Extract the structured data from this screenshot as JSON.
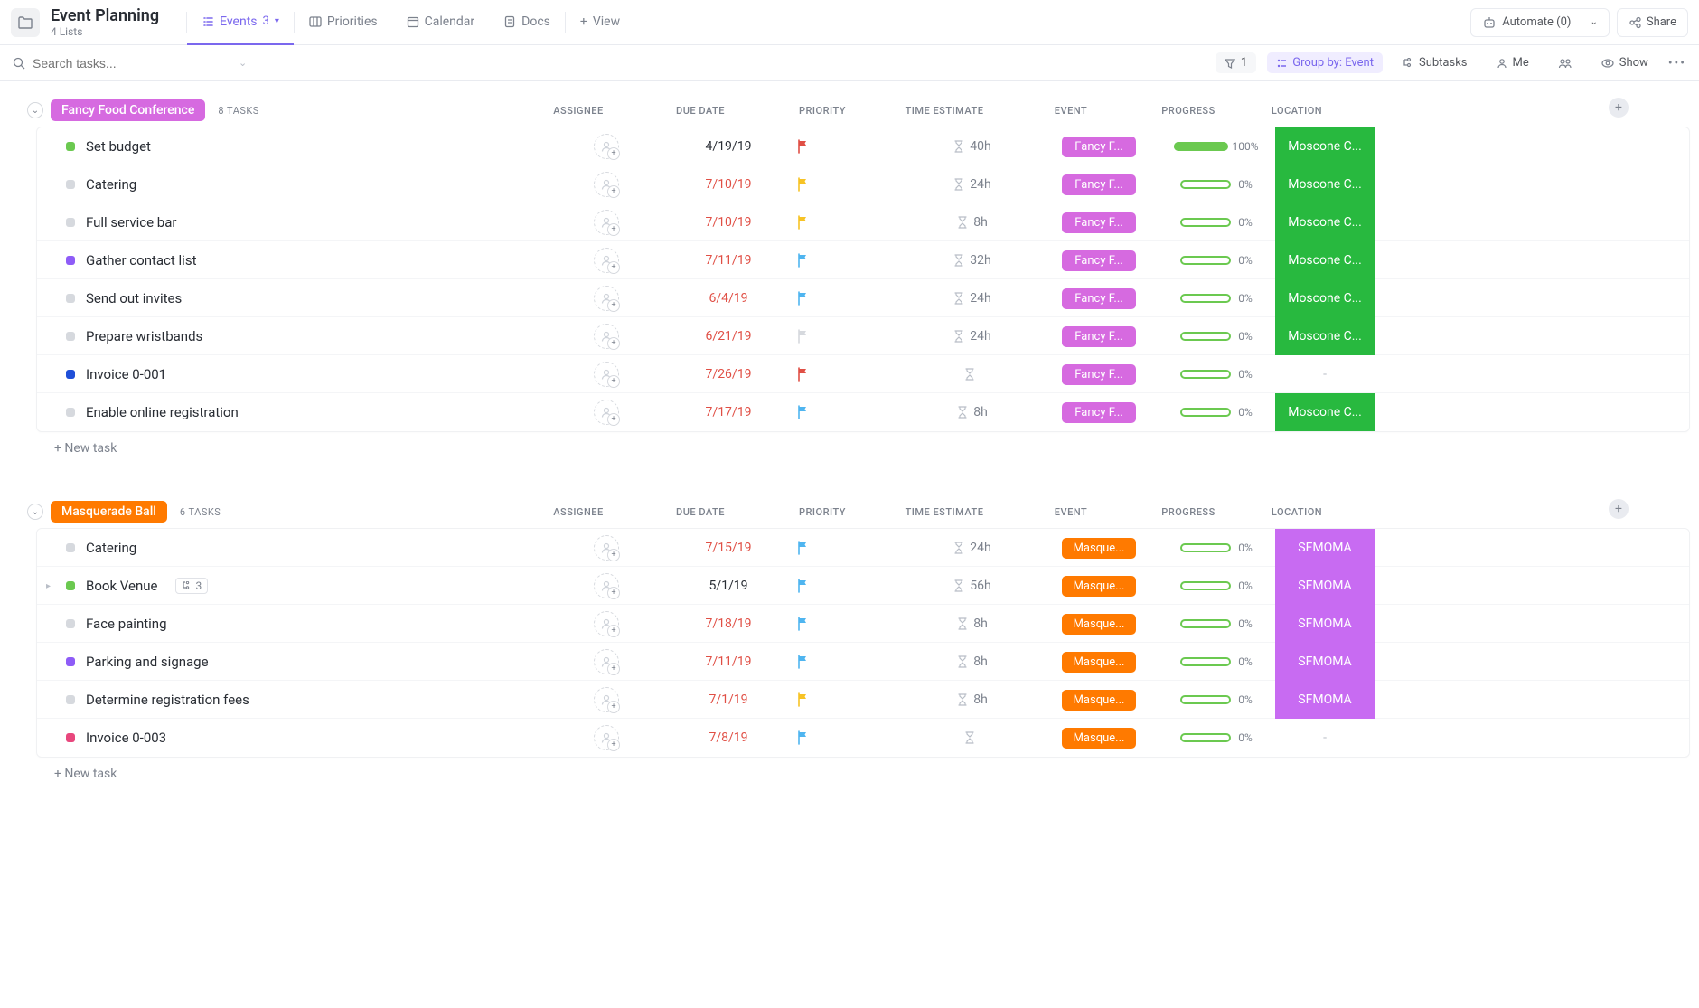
{
  "header": {
    "title": "Event Planning",
    "subtitle": "4 Lists"
  },
  "views": {
    "events": {
      "label": "Events",
      "count": "3"
    },
    "priorities": "Priorities",
    "calendar": "Calendar",
    "docs": "Docs",
    "addView": "View"
  },
  "topRight": {
    "automate": "Automate (0)",
    "share": "Share"
  },
  "search": {
    "placeholder": "Search tasks..."
  },
  "filters": {
    "count": "1",
    "groupBy": "Group by: Event",
    "subtasks": "Subtasks",
    "me": "Me",
    "show": "Show"
  },
  "columns": [
    "ASSIGNEE",
    "DUE DATE",
    "PRIORITY",
    "TIME ESTIMATE",
    "EVENT",
    "PROGRESS",
    "LOCATION"
  ],
  "newTaskLabel": "+ New task",
  "groups": [
    {
      "name": "Fancy Food Conference",
      "pillColor": "#d66ae0",
      "taskCount": "8 TASKS",
      "eventPillColor": "#d66ae0",
      "eventLabel": "Fancy F...",
      "locBg": "#28b93f",
      "tasks": [
        {
          "status": "#6bc950",
          "name": "Set budget",
          "due": "4/19/19",
          "overdue": false,
          "prioColor": "#e04f45",
          "est": "40h",
          "progress": 100,
          "progTxt": "100%",
          "loc": "Moscone C..."
        },
        {
          "status": "#d6d9de",
          "name": "Catering",
          "due": "7/10/19",
          "overdue": true,
          "prioColor": "#f7c325",
          "est": "24h",
          "progress": 0,
          "progTxt": "0%",
          "loc": "Moscone C..."
        },
        {
          "status": "#d6d9de",
          "name": "Full service bar",
          "due": "7/10/19",
          "overdue": true,
          "prioColor": "#f7c325",
          "est": "8h",
          "progress": 0,
          "progTxt": "0%",
          "loc": "Moscone C..."
        },
        {
          "status": "#8e5cf7",
          "name": "Gather contact list",
          "due": "7/11/19",
          "overdue": true,
          "prioColor": "#4fb5f0",
          "est": "32h",
          "progress": 0,
          "progTxt": "0%",
          "loc": "Moscone C..."
        },
        {
          "status": "#d6d9de",
          "name": "Send out invites",
          "due": "6/4/19",
          "overdue": true,
          "prioColor": "#4fb5f0",
          "est": "24h",
          "progress": 0,
          "progTxt": "0%",
          "loc": "Moscone C..."
        },
        {
          "status": "#d6d9de",
          "name": "Prepare wristbands",
          "due": "6/21/19",
          "overdue": true,
          "prioColor": "#d6d9de",
          "est": "24h",
          "progress": 0,
          "progTxt": "0%",
          "loc": "Moscone C..."
        },
        {
          "status": "#1f4fd8",
          "name": "Invoice 0-001",
          "due": "7/26/19",
          "overdue": true,
          "prioColor": "#e04f45",
          "est": "",
          "progress": 0,
          "progTxt": "0%",
          "loc": "-",
          "locNone": true
        },
        {
          "status": "#d6d9de",
          "name": "Enable online registration",
          "due": "7/17/19",
          "overdue": true,
          "prioColor": "#4fb5f0",
          "est": "8h",
          "progress": 0,
          "progTxt": "0%",
          "loc": "Moscone C..."
        }
      ]
    },
    {
      "name": "Masquerade Ball",
      "pillColor": "#ff7a00",
      "taskCount": "6 TASKS",
      "eventPillColor": "#ff7a00",
      "eventLabel": "Masque...",
      "locBg": "#c86bf2",
      "tasks": [
        {
          "status": "#d6d9de",
          "name": "Catering",
          "due": "7/15/19",
          "overdue": true,
          "prioColor": "#4fb5f0",
          "est": "24h",
          "progress": 0,
          "progTxt": "0%",
          "loc": "SFMOMA"
        },
        {
          "status": "#6bc950",
          "name": "Book Venue",
          "due": "5/1/19",
          "overdue": false,
          "prioColor": "#4fb5f0",
          "est": "56h",
          "progress": 0,
          "progTxt": "0%",
          "loc": "SFMOMA",
          "subCount": "3",
          "hasExpand": true
        },
        {
          "status": "#d6d9de",
          "name": "Face painting",
          "due": "7/18/19",
          "overdue": true,
          "prioColor": "#4fb5f0",
          "est": "8h",
          "progress": 0,
          "progTxt": "0%",
          "loc": "SFMOMA"
        },
        {
          "status": "#8e5cf7",
          "name": "Parking and signage",
          "due": "7/11/19",
          "overdue": true,
          "prioColor": "#4fb5f0",
          "est": "8h",
          "progress": 0,
          "progTxt": "0%",
          "loc": "SFMOMA"
        },
        {
          "status": "#d6d9de",
          "name": "Determine registration fees",
          "due": "7/1/19",
          "overdue": true,
          "prioColor": "#f7c325",
          "est": "8h",
          "progress": 0,
          "progTxt": "0%",
          "loc": "SFMOMA"
        },
        {
          "status": "#e8477d",
          "name": "Invoice 0-003",
          "due": "7/8/19",
          "overdue": true,
          "prioColor": "#4fb5f0",
          "est": "",
          "progress": 0,
          "progTxt": "0%",
          "loc": "-",
          "locNone": true
        }
      ]
    }
  ]
}
